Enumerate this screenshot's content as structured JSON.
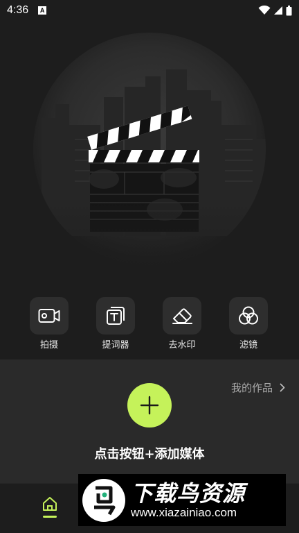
{
  "status_bar": {
    "time": "4:36",
    "notification_glyph": "A",
    "icons": [
      "wifi-icon",
      "signal-icon",
      "battery-icon"
    ]
  },
  "hero": {
    "icon": "clapperboard-icon"
  },
  "tools": [
    {
      "label": "拍摄",
      "icon": "video-camera-icon"
    },
    {
      "label": "提词器",
      "icon": "teleprompter-icon"
    },
    {
      "label": "去水印",
      "icon": "eraser-icon"
    },
    {
      "label": "滤镜",
      "icon": "filter-circles-icon"
    }
  ],
  "panel": {
    "my_works_label": "我的作品",
    "add_label": "点击按钮+添加媒体"
  },
  "nav": {
    "home_icon": "home-icon"
  },
  "watermark": {
    "title": "下载鸟资源",
    "url": "www.xiazainiao.com"
  },
  "colors": {
    "accent": "#c5f25a",
    "background": "#1d1d1d",
    "panel": "#2a2a2a",
    "tool_box": "#2e2e2e"
  }
}
